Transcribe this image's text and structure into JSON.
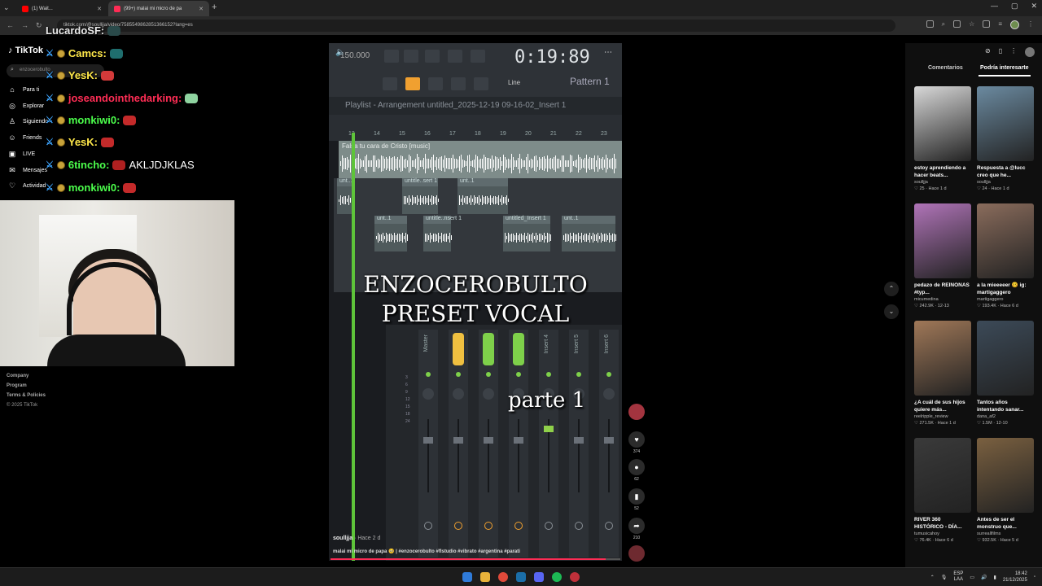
{
  "browser": {
    "tabs": [
      {
        "title": "(1) Wait...",
        "color": "#ff0000"
      },
      {
        "title": "(99+) malai mi micro de pa",
        "color": "#fe2c55"
      }
    ],
    "new_tab": "+",
    "url": "tiktok.com/@soulljja/video/7585549862851366152?lang=es"
  },
  "tiktok": {
    "logo": "TikTok",
    "search_placeholder": "enzocerobulto",
    "nav": [
      {
        "label": "Para ti",
        "icon": "home-icon"
      },
      {
        "label": "Explorar",
        "icon": "compass-icon"
      },
      {
        "label": "Siguiendo",
        "icon": "following-icon"
      },
      {
        "label": "Friends",
        "icon": "friends-icon"
      },
      {
        "label": "LIVE",
        "icon": "live-icon"
      },
      {
        "label": "Mensajes",
        "icon": "messages-icon"
      },
      {
        "label": "Actividad",
        "icon": "activity-icon"
      }
    ],
    "footer": [
      "Company",
      "Program",
      "Terms & Policies",
      "© 2025 TikTok"
    ]
  },
  "chat": [
    {
      "user": "LucardoSF:",
      "color": "#eaeaea"
    },
    {
      "user": "Camcs:",
      "color": "#ffe84a"
    },
    {
      "user": "YesK:",
      "color": "#ffe84a"
    },
    {
      "user": "joseandointhedarking:",
      "color": "#ff2d55"
    },
    {
      "user": "monkiwi0:",
      "color": "#4cff4c"
    },
    {
      "user": "YesK:",
      "color": "#ffe84a"
    },
    {
      "user": "6tincho:",
      "color": "#4cff4c",
      "message": "AKLJDJKLAS"
    },
    {
      "user": "monkiwi0:",
      "color": "#4cff4c"
    }
  ],
  "video": {
    "daw": {
      "tempo": "150.000",
      "time": "0:19:89",
      "line_mode": "Line",
      "pattern": "Pattern 1",
      "playlist_title": "Playlist - Arrangement  untitled_2025-12-19 09-16-02_Insert 1",
      "ruler": [
        "13",
        "14",
        "15",
        "16",
        "17",
        "18",
        "19",
        "20",
        "21",
        "22",
        "23"
      ],
      "track_main": "Falsa tu cara de Cristo [music]",
      "clips": [
        "unt..1",
        "untitle..sert 1",
        "unt..1",
        "unt..1",
        "untitle..nsert 1",
        "untitled_Insert 1",
        "unt..1"
      ],
      "mixer_strips": [
        "Master",
        "Insert 1",
        "Insert 2",
        "Insert 3",
        "Insert 4",
        "Insert 5",
        "Insert 6"
      ],
      "fader_numbers": [
        "3",
        "6",
        "9",
        "12",
        "15",
        "18",
        "24"
      ]
    },
    "overlay_title_1": "ENZOCEROBULTO",
    "overlay_title_2": "PRESET VOCAL",
    "overlay_part": "parte 1",
    "author": "soulljja",
    "posted": "· Hace 2 d",
    "description": "malai mi micro de papa 🥺 | #enzocerobulto #flstudio #vibrato #argentina #parati",
    "progress": 0.95,
    "actions": {
      "likes": "374",
      "comments": "62",
      "saves": "52",
      "shares": "210"
    }
  },
  "right_panel": {
    "tabs": [
      "Comentarios",
      "Podría interesarte"
    ],
    "active_tab": "Podría interesarte",
    "cards": [
      {
        "title": "estoy aprendiendo a hacer beats...",
        "user": "soulljja",
        "likes": "25",
        "time": "Hace 1 d",
        "color": "#d8d8d8"
      },
      {
        "title": "Respuesta a @lucc creo que he...",
        "user": "soulljja",
        "likes": "24",
        "time": "Hace 1 d",
        "color": "#6b8aa0"
      },
      {
        "title": "pedazo de REINONAS #typ...",
        "user": "micumedina",
        "likes": "242.9K",
        "time": "12-13",
        "color": "#b074b8"
      },
      {
        "title": "a la mieeeeer 🥴 ig: martigaggero",
        "user": "martigaggero",
        "likes": "193.4K",
        "time": "Hace 6 d",
        "color": "#8a6c5c"
      },
      {
        "title": "¿A cuál de sus hijos quiere más...",
        "user": "reelripple_review",
        "likes": "271.5K",
        "time": "Hace 1 d",
        "color": "#a07858"
      },
      {
        "title": "Tantos años intentando sanar...",
        "user": "dana_af2",
        "likes": "1.5M",
        "time": "12-10",
        "color": "#3c4a58"
      },
      {
        "title": "RIVER 360 HISTÓRICO - DÍA...",
        "user": "tumusicahoy",
        "likes": "76.4K",
        "time": "Hace 6 d",
        "color": "#3a3a3a"
      },
      {
        "title": "Antes de ser el monstruo que...",
        "user": "surreallfilms",
        "likes": "932.5K",
        "time": "Hace 5 d",
        "color": "#7a6040"
      }
    ]
  },
  "taskbar": {
    "lang": "ESP",
    "layout": "LAA",
    "time": "18:42",
    "date": "21/12/2025"
  }
}
